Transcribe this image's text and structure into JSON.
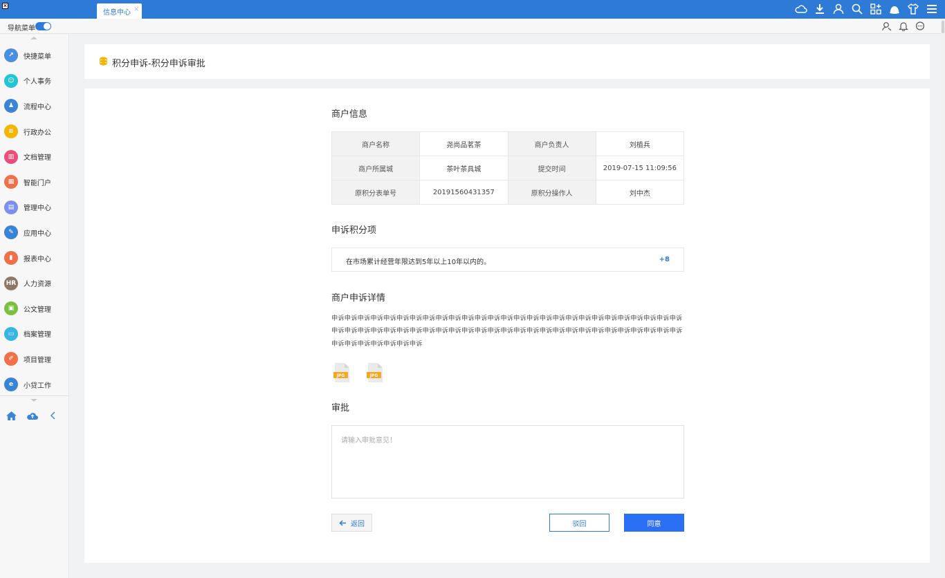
{
  "window": {
    "tab_label": "信息中心",
    "tab_close": "×"
  },
  "top_icons": [
    "cloud-icon",
    "download-icon",
    "user-icon",
    "search-icon",
    "apps-icon",
    "skin-icon",
    "shirt-icon",
    "menu-icon"
  ],
  "subbar": {
    "nav_label": "导航菜单",
    "nav_toggle_on": true
  },
  "sidebar": {
    "items": [
      {
        "label": "快捷菜单",
        "icon": "shortcut-icon",
        "color": "#4a8fe0",
        "glyph": "↗"
      },
      {
        "label": "个人事务",
        "icon": "person-icon",
        "color": "#23c4d6",
        "glyph": "☺"
      },
      {
        "label": "流程中心",
        "icon": "flow-icon",
        "color": "#3a84d8",
        "glyph": "♟"
      },
      {
        "label": "行政办公",
        "icon": "layers-icon",
        "color": "#f5b400",
        "glyph": "≋"
      },
      {
        "label": "文档管理",
        "icon": "book-icon",
        "color": "#ea4f7c",
        "glyph": "▥"
      },
      {
        "label": "智能门户",
        "icon": "building-icon",
        "color": "#f0704a",
        "glyph": "▦"
      },
      {
        "label": "管理中心",
        "icon": "document-icon",
        "color": "#7b8ff0",
        "glyph": "▤"
      },
      {
        "label": "应用中心",
        "icon": "edit-icon",
        "color": "#3a84d8",
        "glyph": "✎"
      },
      {
        "label": "报表中心",
        "icon": "chart-icon",
        "color": "#f0704a",
        "glyph": "▮"
      },
      {
        "label": "人力资源",
        "icon": "hr-icon",
        "color": "#8d7766",
        "glyph": "HR"
      },
      {
        "label": "公文管理",
        "icon": "briefcase-icon",
        "color": "#7cc043",
        "glyph": "▣"
      },
      {
        "label": "档案管理",
        "icon": "archive-icon",
        "color": "#36b6e3",
        "glyph": "▭"
      },
      {
        "label": "项目管理",
        "icon": "project-icon",
        "color": "#f0704a",
        "glyph": "✐"
      },
      {
        "label": "小贷工作",
        "icon": "ie-icon",
        "color": "#3a84d8",
        "glyph": "e"
      }
    ]
  },
  "page": {
    "title": "积分申诉-积分申诉审批",
    "merchant_section_title": "商户信息",
    "merchant_table": [
      [
        "商户名称",
        "尧尚品茗茶",
        "商户负责人",
        "刘植兵"
      ],
      [
        "商户所属城",
        "茶叶茶具城",
        "提交时间",
        "2019-07-15 11:09:56"
      ],
      [
        "原积分表单号",
        "20191560431357",
        "原积分操作人",
        "刘中杰"
      ]
    ],
    "score_section_title": "申诉积分项",
    "score_item": {
      "desc": "在市场累计经营年限达到5年以上10年以内的。",
      "value": "+8"
    },
    "detail_section_title": "商户申诉详情",
    "detail_text": "申诉申诉申诉申诉申诉申诉申诉申诉申诉申诉申诉申诉申诉申诉申诉申诉申诉申诉申诉申诉申诉申诉申诉申诉申诉申诉申诉申诉申诉申诉申诉申诉申诉申诉申诉申诉申诉申诉申诉申诉申诉申诉申诉申诉申诉申诉申诉申诉申诉申诉申诉申诉申诉申诉申诉申诉申诉申诉申诉申诉申诉",
    "attachments": [
      {
        "type": "JPG"
      },
      {
        "type": "JPG"
      }
    ],
    "approve_section_title": "审批",
    "approve_placeholder": "请输入审批意见！",
    "buttons": {
      "back": "返回",
      "reject": "驳回",
      "agree": "同意"
    }
  }
}
